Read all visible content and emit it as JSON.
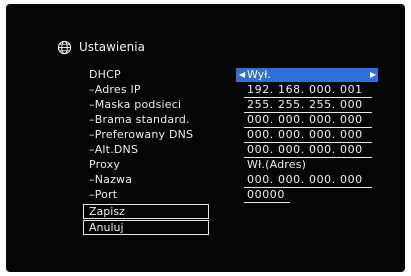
{
  "header": {
    "title": "Ustawienia",
    "icon": "globe-icon"
  },
  "rows": {
    "dhcp": {
      "label": "DHCP",
      "value": "Wył."
    },
    "ip": {
      "label": "–Adres IP",
      "value": "192. 168. 000. 001"
    },
    "mask": {
      "label": "–Maska podsieci",
      "value": "255. 255. 255. 000"
    },
    "gateway": {
      "label": "–Brama standard.",
      "value": "000. 000. 000. 000"
    },
    "dns1": {
      "label": "–Preferowany DNS",
      "value": "000. 000. 000. 000"
    },
    "dns2": {
      "label": "–Alt.DNS",
      "value": "000. 000. 000. 000"
    },
    "proxy": {
      "label": "Proxy",
      "value": "Wł.(Adres)"
    },
    "proxy_name": {
      "label": "–Nazwa",
      "value": "000. 000. 000. 000"
    },
    "proxy_port": {
      "label": "–Port",
      "value": "00000"
    }
  },
  "buttons": {
    "save": "Zapisz",
    "cancel": "Anuluj"
  },
  "colors": {
    "highlight": "#2e6fd9",
    "background": "#050505",
    "text": "#ececec"
  }
}
